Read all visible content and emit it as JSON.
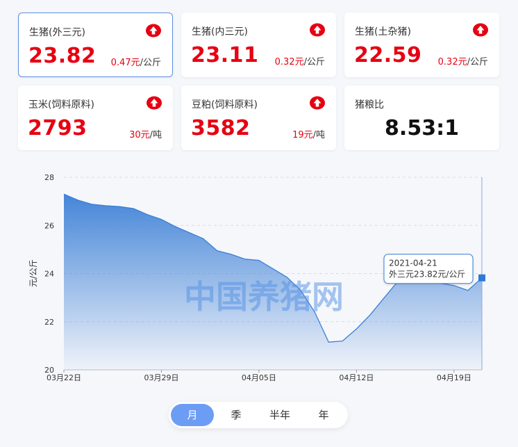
{
  "cards": [
    {
      "title": "生猪(外三元)",
      "price": "23.82",
      "change": "0.47元",
      "unit": "/公斤",
      "trend": "up"
    },
    {
      "title": "生猪(内三元)",
      "price": "23.11",
      "change": "0.32元",
      "unit": "/公斤",
      "trend": "up"
    },
    {
      "title": "生猪(土杂猪)",
      "price": "22.59",
      "change": "0.32元",
      "unit": "/公斤",
      "trend": "up"
    },
    {
      "title": "玉米(饲料原料)",
      "price": "2793",
      "change": "30元",
      "unit": "/吨",
      "trend": "up"
    },
    {
      "title": "豆粕(饲料原料)",
      "price": "3582",
      "change": "19元",
      "unit": "/吨",
      "trend": "up"
    },
    {
      "title": "猪粮比",
      "price": "8.53:1"
    }
  ],
  "colors": {
    "accent": "#e60012",
    "area_top": "#3b7fd6",
    "tab_active": "#6c9df5",
    "watermark": "#4f8fe3"
  },
  "chart_data": {
    "type": "area",
    "ylabel": "元/公斤",
    "ylim": [
      20,
      28
    ],
    "yticks": [
      20,
      22,
      24,
      26,
      28
    ],
    "xticks": [
      "03月22日",
      "03月29日",
      "04月05日",
      "04月12日",
      "04月19日"
    ],
    "x": [
      "2021-03-22",
      "2021-03-23",
      "2021-03-24",
      "2021-03-25",
      "2021-03-26",
      "2021-03-27",
      "2021-03-28",
      "2021-03-29",
      "2021-03-30",
      "2021-03-31",
      "2021-04-01",
      "2021-04-02",
      "2021-04-03",
      "2021-04-04",
      "2021-04-05",
      "2021-04-06",
      "2021-04-07",
      "2021-04-08",
      "2021-04-09",
      "2021-04-10",
      "2021-04-11",
      "2021-04-12",
      "2021-04-13",
      "2021-04-14",
      "2021-04-15",
      "2021-04-16",
      "2021-04-17",
      "2021-04-18",
      "2021-04-19",
      "2021-04-20",
      "2021-04-21"
    ],
    "values": [
      27.3,
      27.05,
      26.88,
      26.82,
      26.78,
      26.7,
      26.45,
      26.25,
      25.95,
      25.7,
      25.45,
      24.95,
      24.8,
      24.6,
      24.55,
      24.2,
      23.85,
      23.3,
      22.4,
      21.15,
      21.2,
      21.7,
      22.3,
      23.0,
      23.7,
      23.9,
      23.7,
      23.6,
      23.5,
      23.3,
      23.82
    ],
    "watermark": "中国养猪网",
    "tooltip": {
      "date": "2021-04-21",
      "series": "外三元",
      "value": "23.82元/公斤"
    }
  },
  "tabs": [
    {
      "label": "月",
      "active": true
    },
    {
      "label": "季"
    },
    {
      "label": "半年"
    },
    {
      "label": "年"
    }
  ]
}
